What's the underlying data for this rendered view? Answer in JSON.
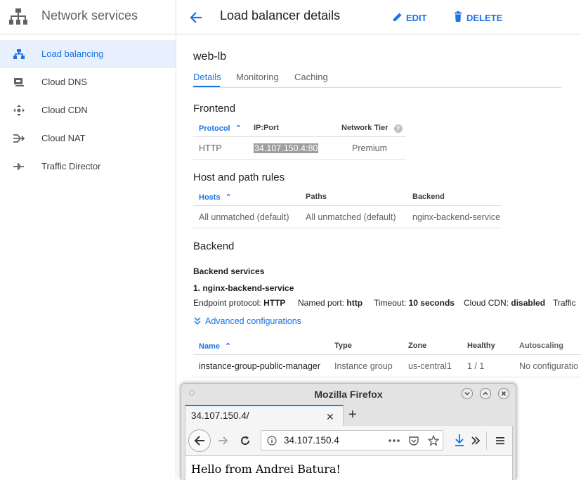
{
  "sidebar": {
    "title": "Network services",
    "items": [
      {
        "label": "Load balancing",
        "icon": "load-balancing-icon",
        "active": true
      },
      {
        "label": "Cloud DNS",
        "icon": "cloud-dns-icon"
      },
      {
        "label": "Cloud CDN",
        "icon": "cloud-cdn-icon"
      },
      {
        "label": "Cloud NAT",
        "icon": "cloud-nat-icon"
      },
      {
        "label": "Traffic Director",
        "icon": "traffic-director-icon"
      }
    ]
  },
  "header": {
    "title": "Load balancer details",
    "edit_label": "EDIT",
    "delete_label": "DELETE"
  },
  "lb": {
    "name": "web-lb",
    "tabs": [
      "Details",
      "Monitoring",
      "Caching"
    ],
    "frontend": {
      "title": "Frontend",
      "headers": [
        "Protocol",
        "IP:Port",
        "Network Tier"
      ],
      "row": {
        "protocol": "HTTP",
        "ip_port": "34.107.150.4:80",
        "tier": "Premium"
      }
    },
    "host_rules": {
      "title": "Host and path rules",
      "headers": [
        "Hosts",
        "Paths",
        "Backend"
      ],
      "row": {
        "hosts": "All unmatched (default)",
        "paths": "All unmatched (default)",
        "backend": "nginx-backend-service"
      }
    },
    "backend": {
      "title": "Backend",
      "services_label": "Backend services",
      "service_name": "1. nginx-backend-service",
      "endpoint_label": "Endpoint protocol:",
      "endpoint_value": "HTTP",
      "port_label": "Named port:",
      "port_value": "http",
      "timeout_label": "Timeout:",
      "timeout_value": "10 seconds",
      "cdn_label": "Cloud CDN:",
      "cdn_value": "disabled",
      "traffic_label": "Traffic",
      "advanced_link": "Advanced configurations",
      "headers": [
        "Name",
        "Type",
        "Zone",
        "Healthy",
        "Autoscaling"
      ],
      "row": {
        "name": "instance-group-public-manager",
        "type": "Instance group",
        "zone": "us-central1",
        "healthy": "1 / 1",
        "autoscaling": "No configuratio"
      }
    }
  },
  "firefox": {
    "window_title": "Mozilla Firefox",
    "tab_title": "34.107.150.4/",
    "url": "34.107.150.4",
    "page_text": "Hello from Andrei Batura!"
  },
  "colors": {
    "accent": "#1a73e8",
    "active_bg": "#e8f0fe",
    "firefox_blue": "#0a84ff"
  }
}
